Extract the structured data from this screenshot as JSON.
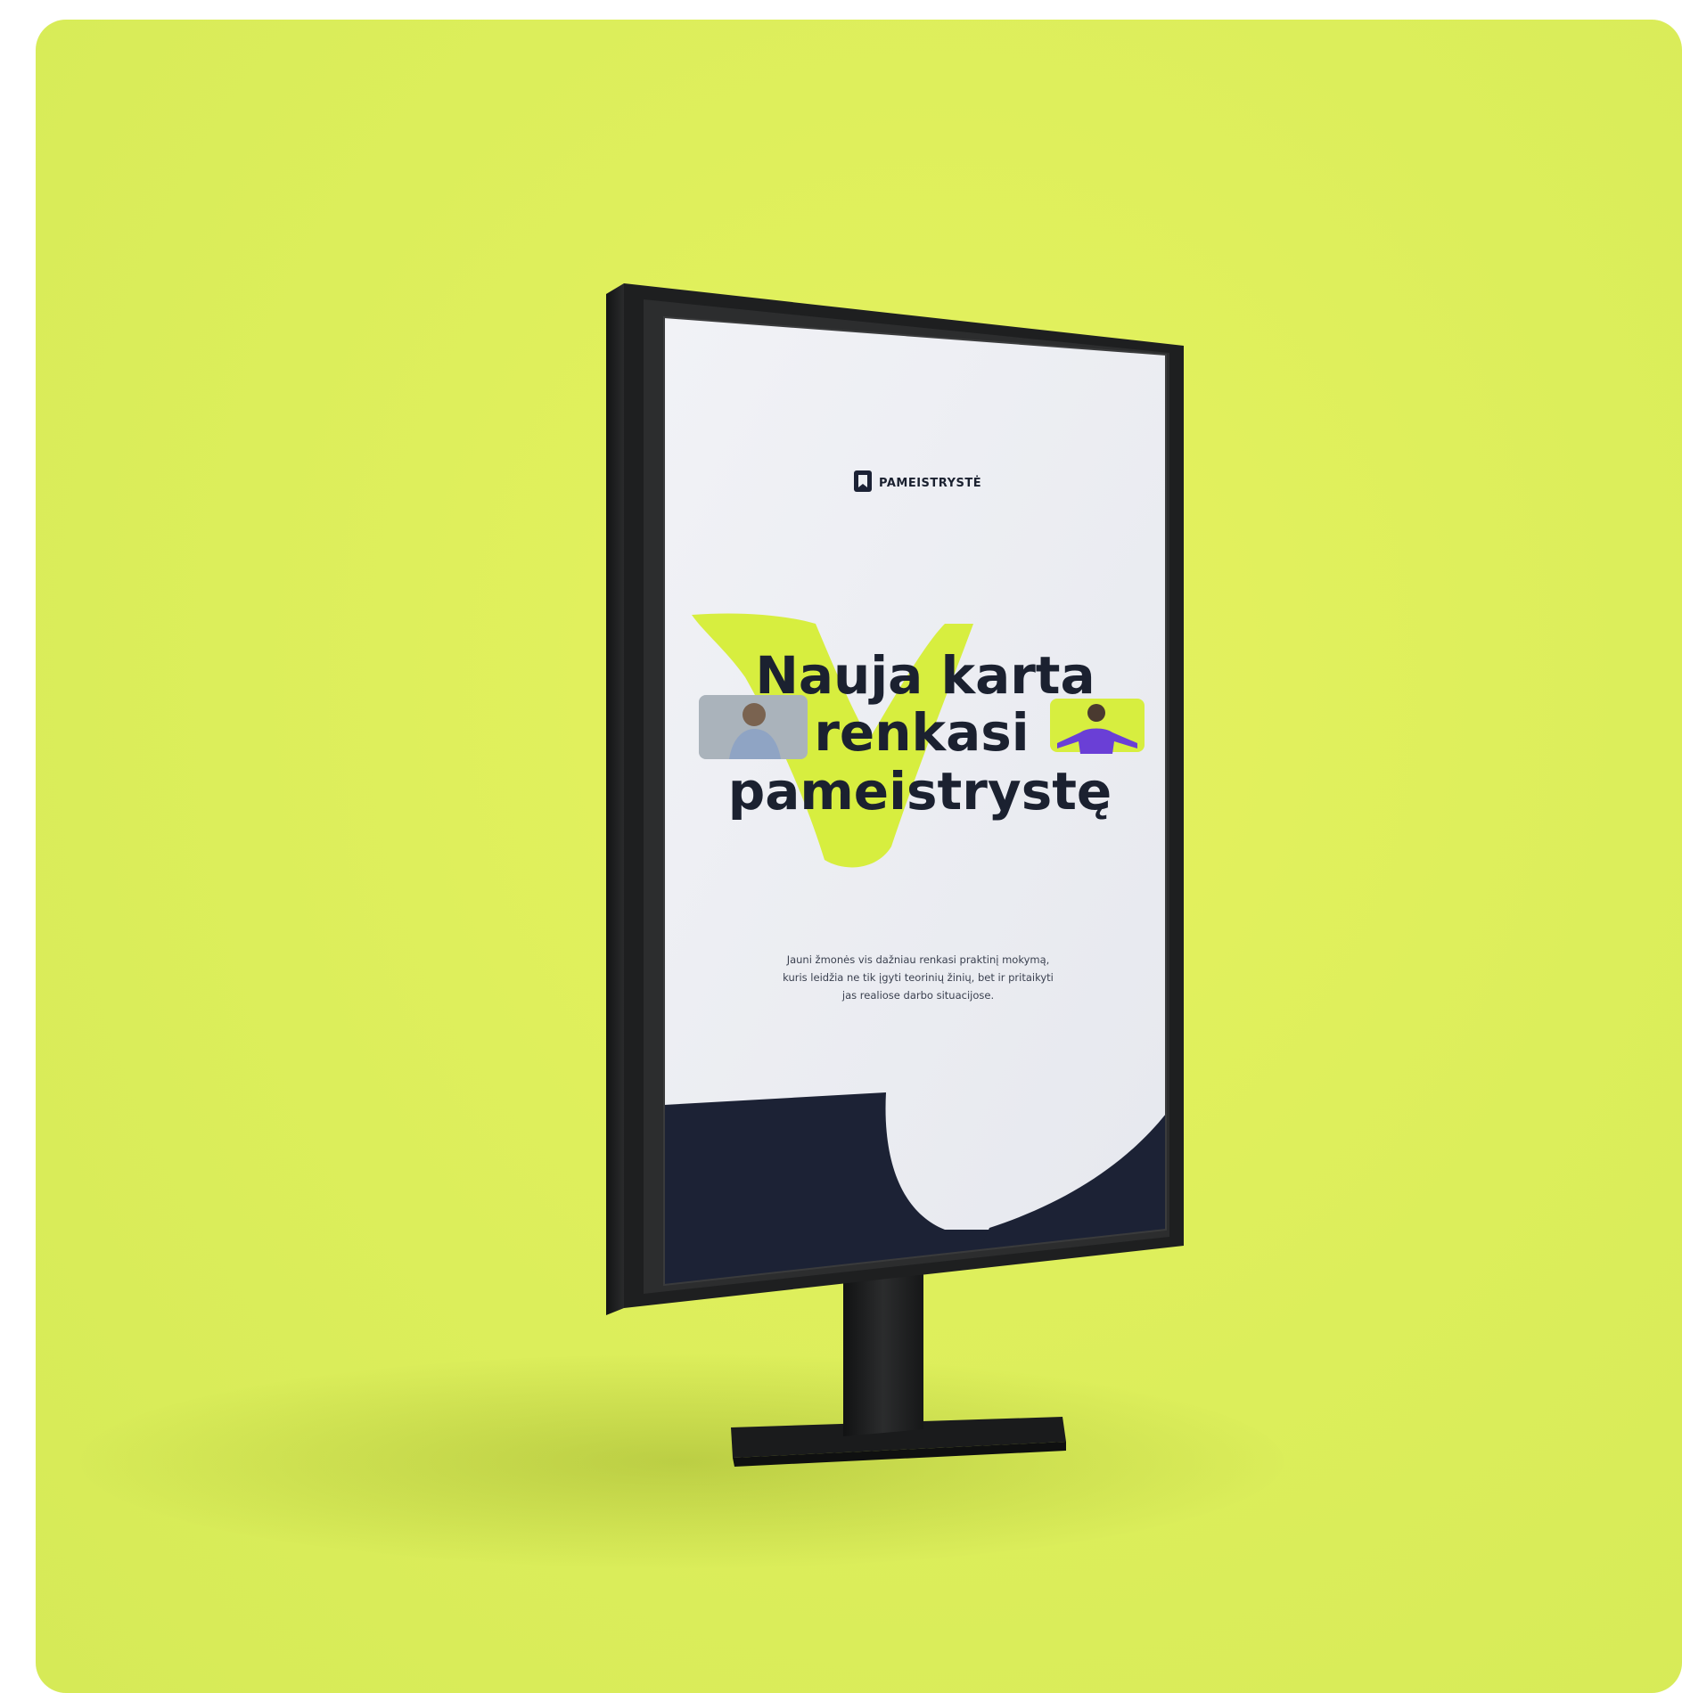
{
  "background_color": "#dcee5b",
  "frame_color": "#1e1f20",
  "poster": {
    "paper_color": "#eef0f4",
    "accent_color": "#d7ee3f",
    "navy_color": "#1c2235",
    "brand": {
      "name": "PAMEISTRYSTĖ",
      "logo_icon": "bookmark-logo-icon"
    },
    "headline": {
      "line1": "Nauja karta",
      "line2": "renkasi",
      "line3": "pameistrystę"
    },
    "body": {
      "line1": "Jauni žmonės vis dažniau renkasi praktinį mokymą,",
      "line2": "kuris leidžia ne tik įgyti teorinių žinių, bet ir pritaikyti",
      "line3": "jas realiose darbo situacijose."
    },
    "photos": [
      {
        "name": "person-photo-left"
      },
      {
        "name": "person-photo-right"
      }
    ]
  }
}
